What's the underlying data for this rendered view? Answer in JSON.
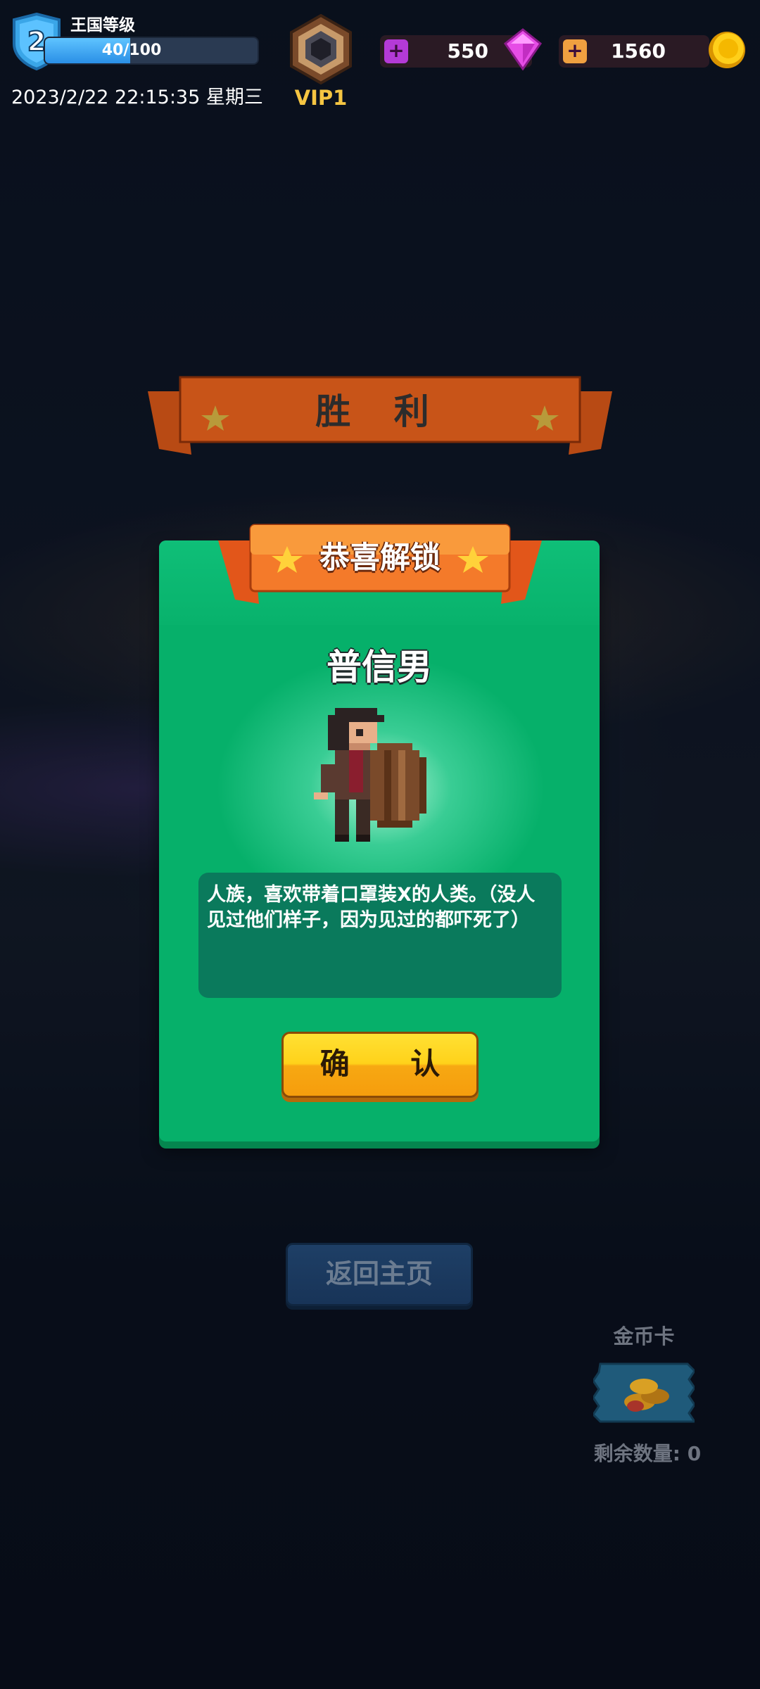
{
  "hud": {
    "level_number": "2",
    "level_title": "王国等级",
    "xp_text": "40/100",
    "xp_progress": 0.4,
    "datetime": "2023/2/22 22:15:35 星期三",
    "vip_label": "VIP1",
    "gems": {
      "value": "550",
      "plus": "+",
      "icon": "gem-icon"
    },
    "coins": {
      "value": "1560",
      "plus": "+",
      "icon": "coin-icon"
    }
  },
  "banner": {
    "title": "胜 利"
  },
  "unlock": {
    "ribbon_title": "恭喜解锁",
    "character_name": "普信男",
    "description": "人族，喜欢带着口罩装X的人类。（没人见过他们样子，因为见过的都吓死了）",
    "confirm_label": "确 认"
  },
  "bottom": {
    "home_label": "返回主页",
    "coin_card_title": "金币卡",
    "coin_card_remaining": "剩余数量: 0"
  },
  "colors": {
    "panel_green": "#06b06a",
    "ribbon_orange": "#f26a21",
    "confirm_yellow": "#ffd21a",
    "vip_gold": "#f5c542",
    "gem_pink": "#e64de6",
    "coin_gold": "#f5b800"
  }
}
